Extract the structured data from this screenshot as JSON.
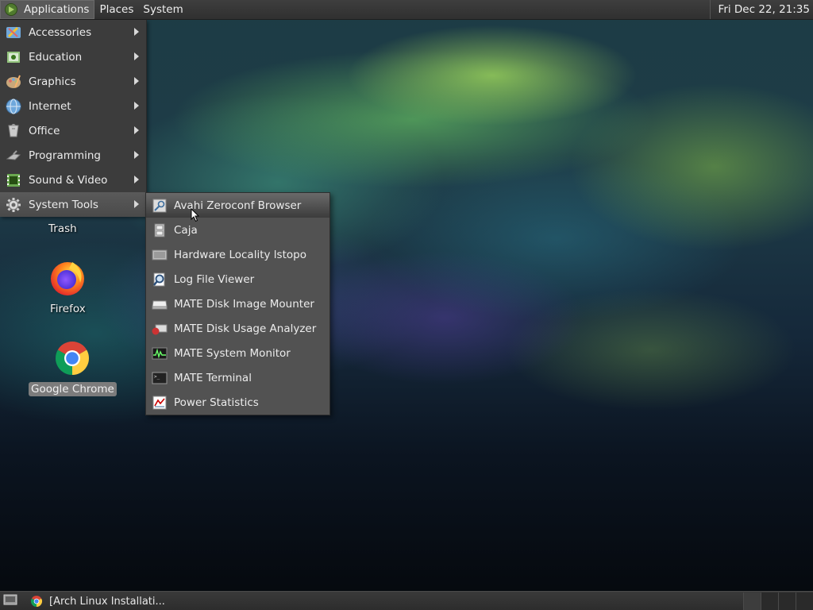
{
  "top_panel": {
    "menus": [
      "Applications",
      "Places",
      "System"
    ],
    "clock": "Fri Dec 22, 21:35"
  },
  "apps_menu": {
    "items": [
      {
        "label": "Accessories",
        "icon": "accessories-icon"
      },
      {
        "label": "Education",
        "icon": "education-icon"
      },
      {
        "label": "Graphics",
        "icon": "graphics-icon"
      },
      {
        "label": "Internet",
        "icon": "internet-icon"
      },
      {
        "label": "Office",
        "icon": "office-icon"
      },
      {
        "label": "Programming",
        "icon": "programming-icon"
      },
      {
        "label": "Sound & Video",
        "icon": "sound-video-icon"
      },
      {
        "label": "System Tools",
        "icon": "system-tools-icon",
        "selected": true
      }
    ]
  },
  "system_tools_menu": {
    "items": [
      {
        "label": "Avahi Zeroconf Browser",
        "icon": "avahi-icon",
        "selected": true
      },
      {
        "label": "Caja",
        "icon": "file-cabinet-icon"
      },
      {
        "label": "Hardware Locality lstopo",
        "icon": "hardware-icon"
      },
      {
        "label": "Log File Viewer",
        "icon": "log-viewer-icon"
      },
      {
        "label": "MATE Disk Image Mounter",
        "icon": "disk-mounter-icon"
      },
      {
        "label": "MATE Disk Usage Analyzer",
        "icon": "disk-usage-icon"
      },
      {
        "label": "MATE System Monitor",
        "icon": "system-monitor-icon"
      },
      {
        "label": "MATE Terminal",
        "icon": "terminal-icon"
      },
      {
        "label": "Power Statistics",
        "icon": "power-statistics-icon"
      }
    ]
  },
  "desktop": {
    "icons": [
      {
        "label": "Trash",
        "icon": "trash-icon"
      },
      {
        "label": "Firefox",
        "icon": "firefox-icon"
      },
      {
        "label": "Google Chrome",
        "icon": "chrome-icon",
        "selected": true
      }
    ]
  },
  "bottom_panel": {
    "task_label": "[Arch Linux Installati...",
    "task_icon": "chrome-icon",
    "workspaces": 4
  }
}
